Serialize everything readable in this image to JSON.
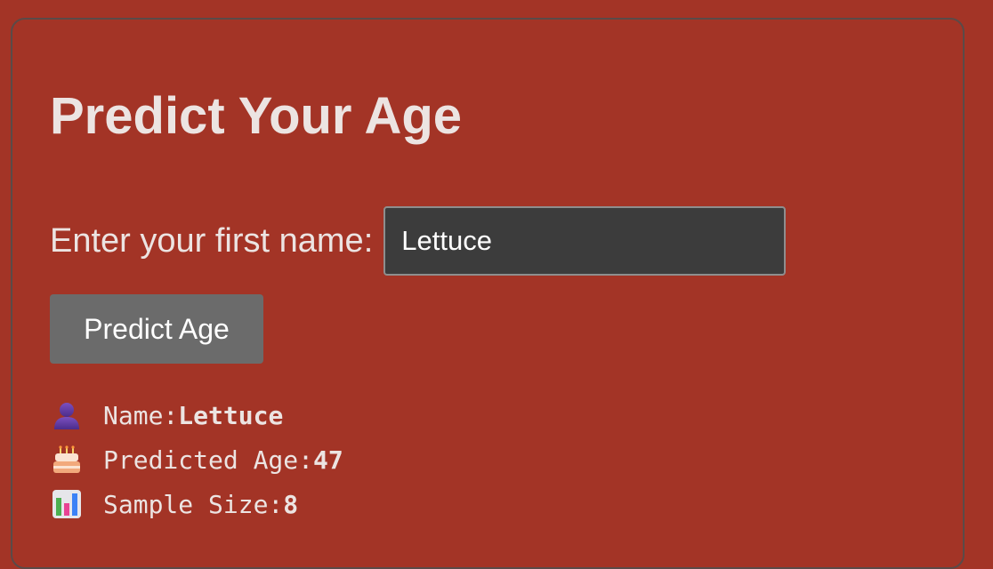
{
  "app": {
    "title": "Predict Your Age"
  },
  "form": {
    "name_label": "Enter your first name:",
    "name_value": "Lettuce",
    "button_label": "Predict Age"
  },
  "results": {
    "name_label": "Name: ",
    "name_value": "Lettuce",
    "age_label": "Predicted Age: ",
    "age_value": "47",
    "sample_label": "Sample Size: ",
    "sample_value": "8"
  },
  "icons": {
    "name": "person-silhouette-icon",
    "age": "birthday-cake-icon",
    "sample": "bar-chart-icon"
  },
  "colors": {
    "background": "#a33426",
    "text": "#ece4e2",
    "input_bg": "#3c3c3c",
    "button_bg": "#6b6b6b"
  }
}
